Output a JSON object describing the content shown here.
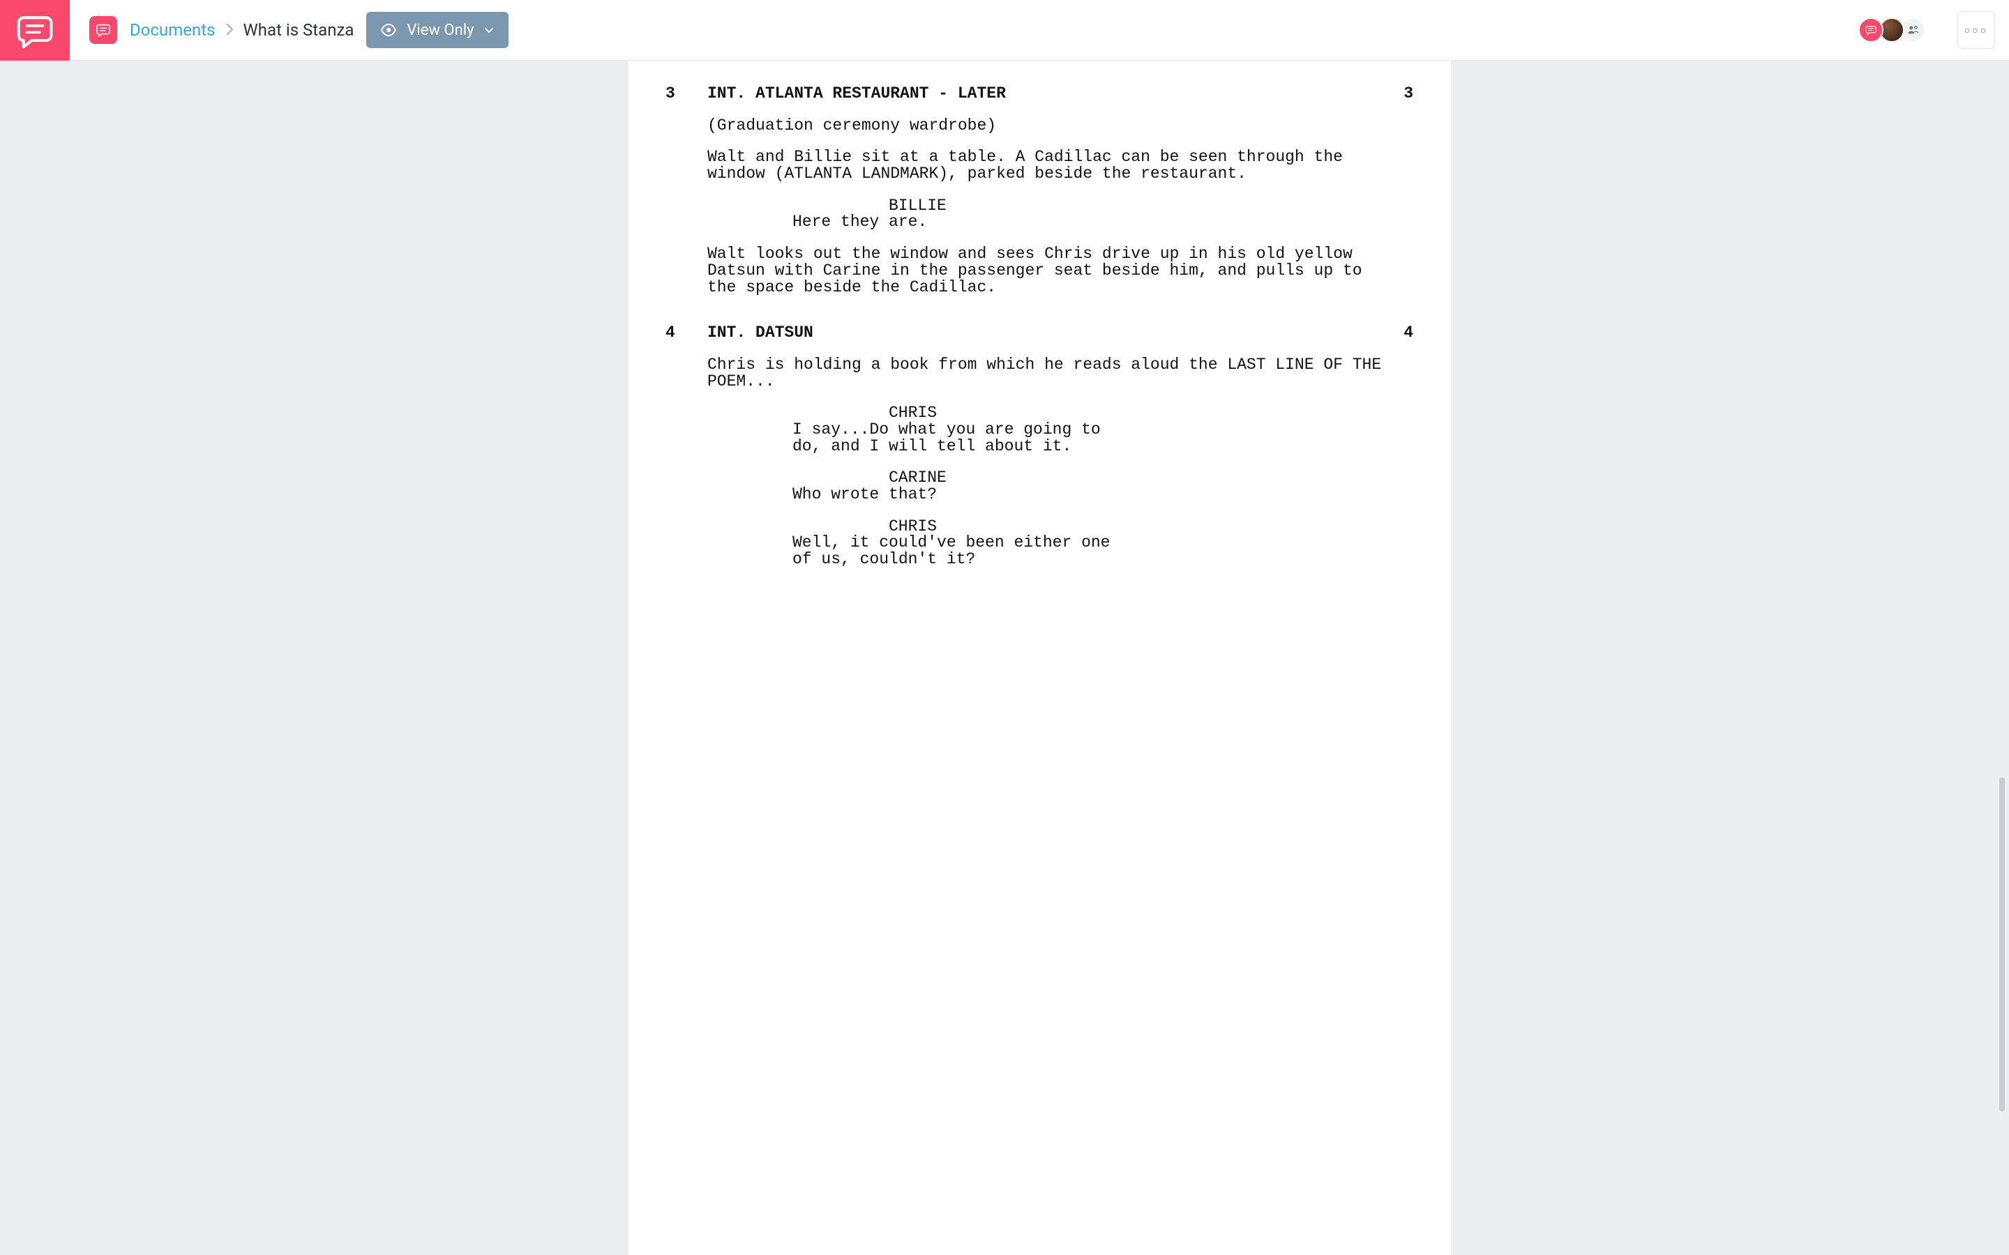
{
  "header": {
    "breadcrumb_root": "Documents",
    "breadcrumb_current": "What is Stanza",
    "view_mode": "View Only"
  },
  "script": {
    "scenes": [
      {
        "num": "3",
        "heading": "INT. ATLANTA RESTAURANT - LATER",
        "elements": [
          {
            "type": "action",
            "text": "(Graduation ceremony wardrobe)"
          },
          {
            "type": "action",
            "text": "Walt and Billie sit at a table. A Cadillac can be seen through the window (ATLANTA LANDMARK), parked beside the restaurant."
          },
          {
            "type": "dialog",
            "character": "BILLIE",
            "text": "Here they are."
          },
          {
            "type": "action",
            "text": "Walt looks out the window and sees Chris drive up in his old yellow Datsun with Carine in the passenger seat beside him, and pulls up to the space beside the Cadillac."
          }
        ]
      },
      {
        "num": "4",
        "heading": "INT. DATSUN",
        "elements": [
          {
            "type": "action",
            "text": "Chris is holding a book from which he reads aloud the LAST LINE OF THE POEM..."
          },
          {
            "type": "dialog",
            "character": "CHRIS",
            "text": "I say...Do what you are going to do, and I will tell about it."
          },
          {
            "type": "dialog",
            "character": "CARINE",
            "text": "Who wrote that?"
          },
          {
            "type": "dialog",
            "character": "CHRIS",
            "text": "Well, it could've been either one of us, couldn't it?"
          }
        ]
      }
    ]
  }
}
